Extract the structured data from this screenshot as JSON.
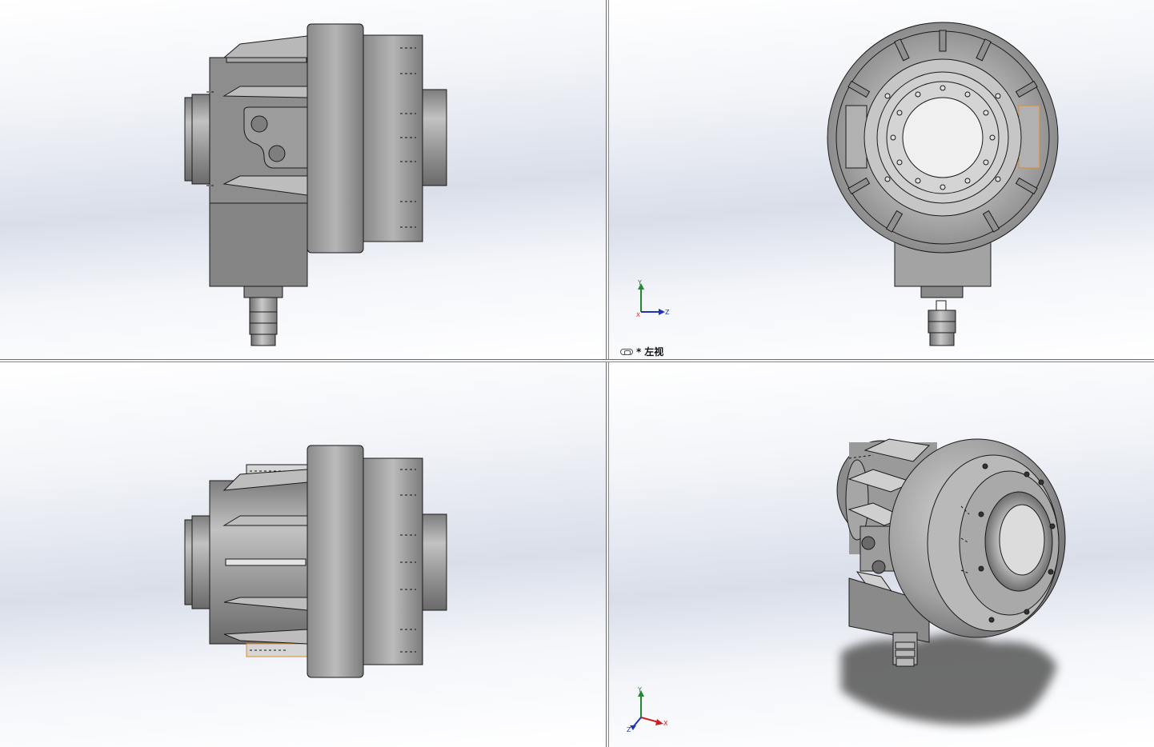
{
  "viewports": {
    "top_left": {
      "view": "front"
    },
    "top_right": {
      "view": "left",
      "label_prefix": "*",
      "label": "左视",
      "link_icon": "chain-link-icon"
    },
    "bottom_left": {
      "view": "top"
    },
    "bottom_right": {
      "view": "isometric"
    }
  },
  "triads": {
    "top_right": {
      "axes": [
        "Y",
        "Z",
        "X"
      ]
    },
    "bottom_right": {
      "axes": [
        "Y",
        "X",
        "Z"
      ]
    }
  },
  "colors": {
    "background_top": "#ffffff",
    "background_mid": "#d9dee9",
    "part_light": "#c9c9c9",
    "part_mid": "#9a9a9a",
    "part_dark": "#5e5e5e",
    "edge": "#1a1a1a",
    "highlight_edge": "#e08a2e",
    "axis_x": "#cc2222",
    "axis_y": "#1f8a2e",
    "axis_z": "#2233bb",
    "shadow": "#555555"
  }
}
